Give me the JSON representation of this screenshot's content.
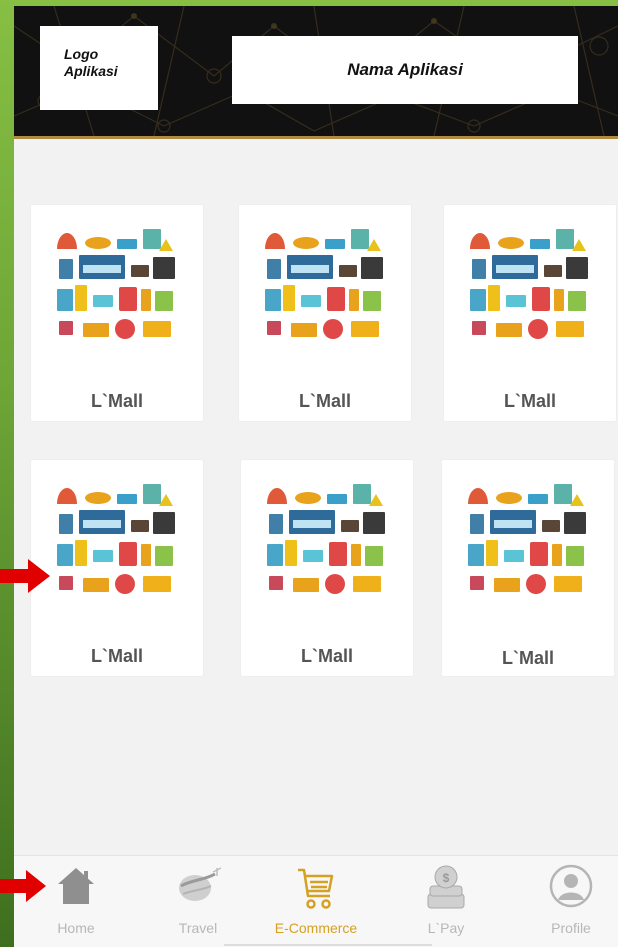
{
  "header": {
    "logo_line1": "Logo",
    "logo_line2": "Aplikasi",
    "app_name": "Nama Aplikasi"
  },
  "products": [
    {
      "label": "L`Mall"
    },
    {
      "label": "L`Mall"
    },
    {
      "label": "L`Mall"
    },
    {
      "label": "L`Mall"
    },
    {
      "label": "L`Mall"
    },
    {
      "label": "L`Mall"
    }
  ],
  "bottom_nav": {
    "items": [
      {
        "label": "Home",
        "icon": "home-icon"
      },
      {
        "label": "Travel",
        "icon": "airplane-globe-icon"
      },
      {
        "label": "E-Commerce",
        "icon": "shopping-cart-icon",
        "active": true
      },
      {
        "label": "L`Pay",
        "icon": "coin-stack-icon"
      },
      {
        "label": "Profile",
        "icon": "user-icon"
      }
    ]
  },
  "colors": {
    "active": "#d5a122",
    "inactive": "#b7b7b7",
    "header_bg": "#111111",
    "frame_green": "#6ea637",
    "arrow_red": "#e10000"
  }
}
